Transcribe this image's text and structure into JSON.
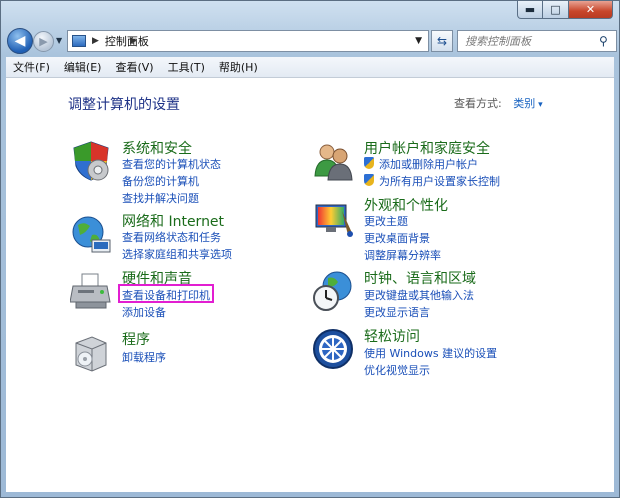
{
  "window": {
    "minimize_symbol": "▬",
    "maximize_symbol": "□",
    "close_symbol": "✕"
  },
  "nav": {
    "back_symbol": "◀",
    "forward_symbol": "▶",
    "address_text": "控制面板",
    "search_placeholder": "搜索控制面板"
  },
  "menu": {
    "items": [
      "文件(F)",
      "编辑(E)",
      "查看(V)",
      "工具(T)",
      "帮助(H)"
    ]
  },
  "content": {
    "title": "调整计算机的设置",
    "view_by_label": "查看方式:",
    "view_by_value": "类别"
  },
  "categories": {
    "system": {
      "heading": "系统和安全",
      "icon": "shield-icon",
      "links": [
        "查看您的计算机状态",
        "备份您的计算机",
        "查找并解决问题"
      ]
    },
    "network": {
      "heading": "网络和 Internet",
      "icon": "network-globe-icon",
      "links": [
        "查看网络状态和任务",
        "选择家庭组和共享选项"
      ]
    },
    "hardware": {
      "heading": "硬件和声音",
      "icon": "printer-icon",
      "links": [
        "查看设备和打印机",
        "添加设备"
      ]
    },
    "programs": {
      "heading": "程序",
      "icon": "program-box-icon",
      "links": [
        "卸载程序"
      ]
    },
    "users": {
      "heading": "用户帐户和家庭安全",
      "icon": "users-icon",
      "links": [
        "添加或删除用户帐户",
        "为所有用户设置家长控制"
      ]
    },
    "appearance": {
      "heading": "外观和个性化",
      "icon": "display-paint-icon",
      "links": [
        "更改主题",
        "更改桌面背景",
        "调整屏幕分辨率"
      ]
    },
    "clock": {
      "heading": "时钟、语言和区域",
      "icon": "clock-globe-icon",
      "links": [
        "更改键盘或其他输入法",
        "更改显示语言"
      ]
    },
    "access": {
      "heading": "轻松访问",
      "icon": "ease-of-access-icon",
      "links": [
        "使用 Windows 建议的设置",
        "优化视觉显示"
      ]
    }
  },
  "colors": {
    "heading_green": "#1a6b1a",
    "link_blue": "#1a4fb8",
    "highlight_magenta": "#e21ed1"
  }
}
